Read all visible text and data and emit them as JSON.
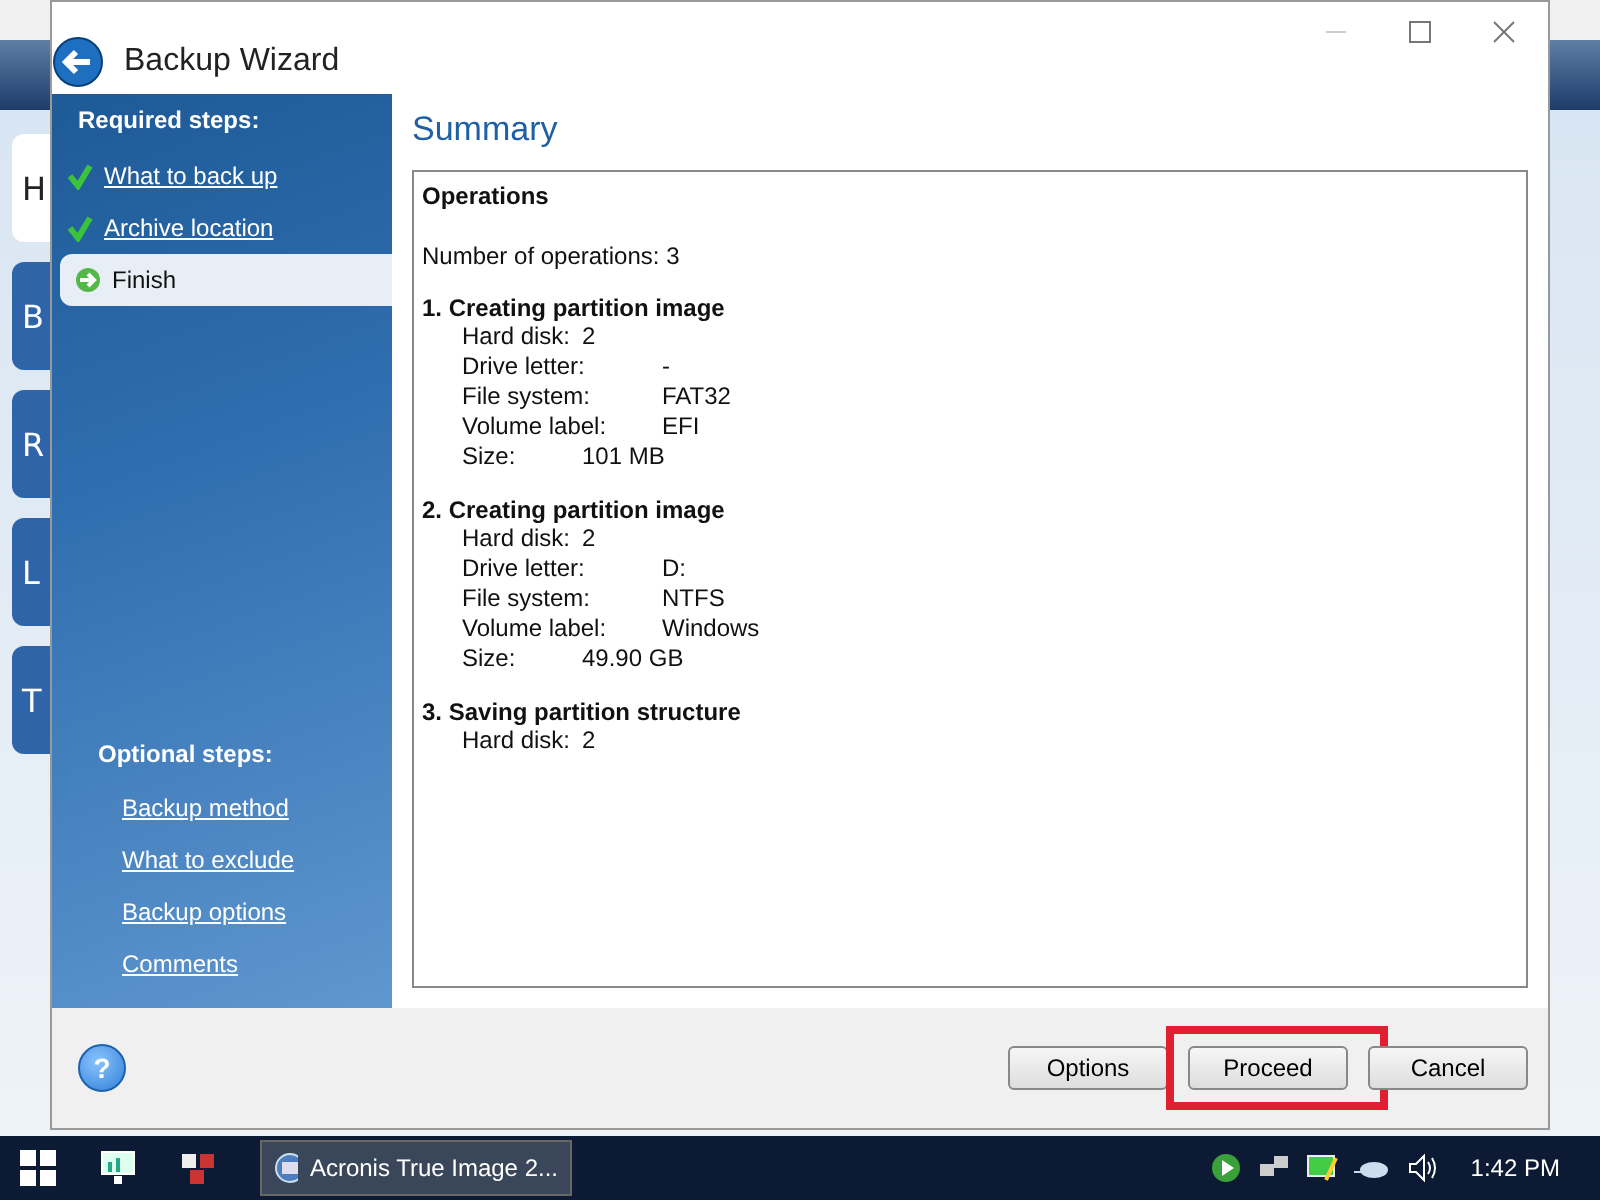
{
  "background_app": {
    "tiles": [
      "H",
      "B",
      "R",
      "L",
      "T"
    ]
  },
  "window": {
    "title": "Backup Wizard"
  },
  "sidebar": {
    "required_heading": "Required steps:",
    "required_steps": [
      {
        "label": "What to back up",
        "done": true,
        "selected": false
      },
      {
        "label": "Archive location",
        "done": true,
        "selected": false
      },
      {
        "label": "Finish",
        "done": false,
        "selected": true
      }
    ],
    "optional_heading": "Optional steps:",
    "optional_steps": [
      "Backup method",
      "What to exclude",
      "Backup options",
      "Comments"
    ]
  },
  "content": {
    "title": "Summary",
    "heading": "Operations",
    "count": "Number of operations: 3",
    "operations": [
      {
        "title": "1. Creating partition image",
        "rows": [
          {
            "label": "Hard disk:",
            "value": "2",
            "kind": "tight"
          },
          {
            "label": "Drive letter:",
            "value": "-",
            "kind": "wide"
          },
          {
            "label": "File system:",
            "value": "FAT32",
            "kind": "wide"
          },
          {
            "label": "Volume label:",
            "value": "EFI",
            "kind": "wide"
          },
          {
            "label": "Size:",
            "value": "101 MB",
            "kind": "mid"
          }
        ]
      },
      {
        "title": "2. Creating partition image",
        "rows": [
          {
            "label": "Hard disk:",
            "value": "2",
            "kind": "tight"
          },
          {
            "label": "Drive letter:",
            "value": "D:",
            "kind": "wide"
          },
          {
            "label": "File system:",
            "value": "NTFS",
            "kind": "wide"
          },
          {
            "label": "Volume label:",
            "value": "Windows",
            "kind": "wide"
          },
          {
            "label": "Size:",
            "value": "49.90 GB",
            "kind": "mid"
          }
        ]
      },
      {
        "title": "3. Saving partition structure",
        "rows": [
          {
            "label": "Hard disk:",
            "value": "2",
            "kind": "tight"
          }
        ]
      }
    ]
  },
  "help": "?",
  "buttons": [
    {
      "label": "Options",
      "highlighted": false
    },
    {
      "label": "Proceed",
      "highlighted": true
    },
    {
      "label": "Cancel",
      "highlighted": false
    }
  ],
  "taskbar": {
    "app": "Acronis True Image 2...",
    "time": "1:42 PM"
  }
}
